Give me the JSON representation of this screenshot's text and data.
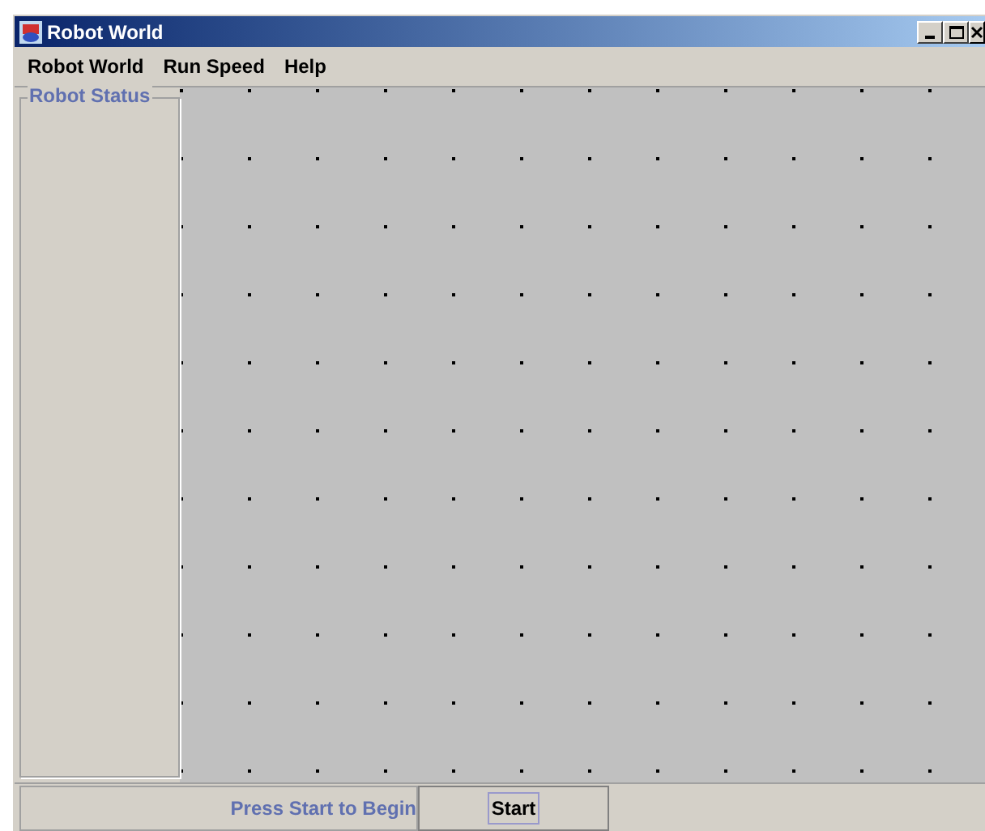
{
  "window": {
    "title": "Robot World"
  },
  "menu": [
    "Robot World",
    "Run Speed",
    "Help"
  ],
  "status_panel": {
    "title": "Robot Status"
  },
  "bottom_bar": {
    "message": "Press Start to Begin",
    "button": "Start"
  }
}
